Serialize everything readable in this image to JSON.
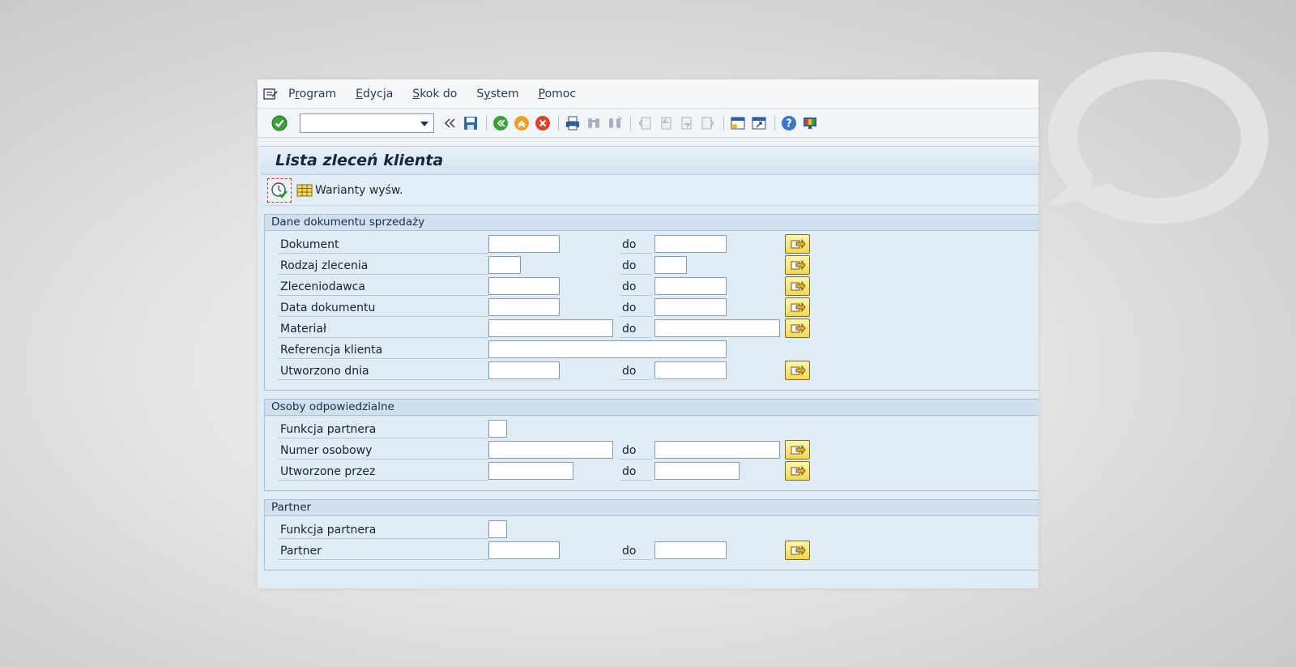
{
  "menu": [
    {
      "label": "Program",
      "underline_index": 1
    },
    {
      "label": "Edycja",
      "underline_index": 0
    },
    {
      "label": "Skok do",
      "underline_index": 0
    },
    {
      "label": "System",
      "underline_index": 1
    },
    {
      "label": "Pomoc",
      "underline_index": 0
    }
  ],
  "toolbar": {
    "command_field_value": "",
    "icons": [
      "enter-check-icon",
      "command-field",
      "back-double-icon",
      "save-icon",
      "back-icon",
      "exit-icon",
      "cancel-icon",
      "print-icon",
      "find-icon",
      "find-next-icon",
      "first-page-icon",
      "previous-page-icon",
      "next-page-icon",
      "last-page-icon",
      "new-session-icon",
      "shortcut-icon",
      "help-icon",
      "customize-layout-icon"
    ]
  },
  "page": {
    "title": "Lista zleceń klienta",
    "variants_label": "Warianty wyśw."
  },
  "groups": [
    {
      "title": "Dane dokumentu sprzedaży",
      "rows": [
        {
          "label": "Dokument",
          "from": "",
          "to_label": "do",
          "to": ""
        },
        {
          "label": "Rodzaj zlecenia",
          "from": "",
          "to_label": "do",
          "to": ""
        },
        {
          "label": "Zleceniodawca",
          "from": "",
          "to_label": "do",
          "to": ""
        },
        {
          "label": "Data dokumentu",
          "from": "",
          "to_label": "do",
          "to": ""
        },
        {
          "label": "Materiał",
          "from": "",
          "to_label": "do",
          "to": ""
        },
        {
          "label": "Referencja klienta",
          "from": ""
        },
        {
          "label": "Utworzono dnia",
          "from": "",
          "to_label": "do",
          "to": ""
        }
      ]
    },
    {
      "title": "Osoby odpowiedzialne",
      "rows": [
        {
          "label": "Funkcja partnera",
          "from": ""
        },
        {
          "label": "Numer osobowy",
          "from": "",
          "to_label": "do",
          "to": ""
        },
        {
          "label": "Utworzone przez",
          "from": "",
          "to_label": "do",
          "to": ""
        }
      ]
    },
    {
      "title": "Partner",
      "rows": [
        {
          "label": "Funkcja partnera",
          "from": ""
        },
        {
          "label": "Partner",
          "from": "",
          "to_label": "do",
          "to": ""
        }
      ]
    }
  ],
  "colors": {
    "window_bg": "#dfebf5",
    "group_head": "#cfe0ee",
    "multi_button": "#f2d653"
  }
}
